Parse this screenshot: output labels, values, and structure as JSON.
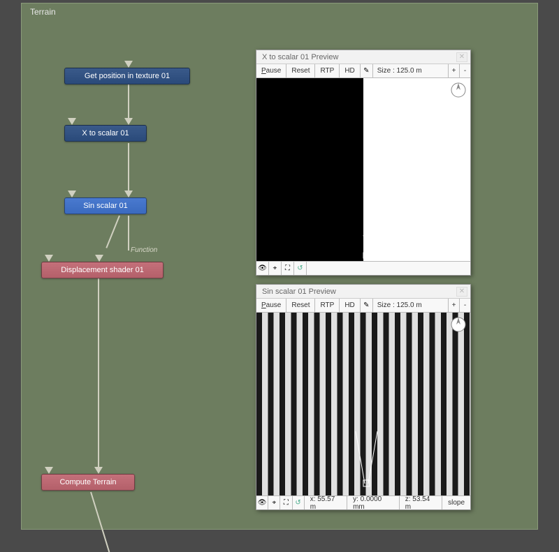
{
  "panel": {
    "title": "Terrain"
  },
  "nodes": {
    "get_pos": {
      "label": "Get position in texture 01"
    },
    "x_to_scalar": {
      "label": "X to scalar 01"
    },
    "sin_scalar": {
      "label": "Sin scalar 01"
    },
    "displacement": {
      "label": "Displacement shader 01"
    },
    "compute": {
      "label": "Compute Terrain"
    },
    "function_label": "Function"
  },
  "preview1": {
    "title": "X to scalar 01 Preview",
    "toolbar": {
      "pause": "Pause",
      "reset": "Reset",
      "rtp": "RTP",
      "hd": "HD",
      "size": "Size : 125.0 m",
      "plus": "+",
      "minus": "-"
    }
  },
  "preview2": {
    "title": "Sin scalar 01 Preview",
    "toolbar": {
      "pause": "Pause",
      "reset": "Reset",
      "rtp": "RTP",
      "hd": "HD",
      "size": "Size : 125.0 m",
      "plus": "+",
      "minus": "-"
    },
    "footer": {
      "x": "x: 55.57 m",
      "y": "y: 0.0000 mm",
      "z": "z: 53.54 m",
      "slope": "slope"
    }
  }
}
